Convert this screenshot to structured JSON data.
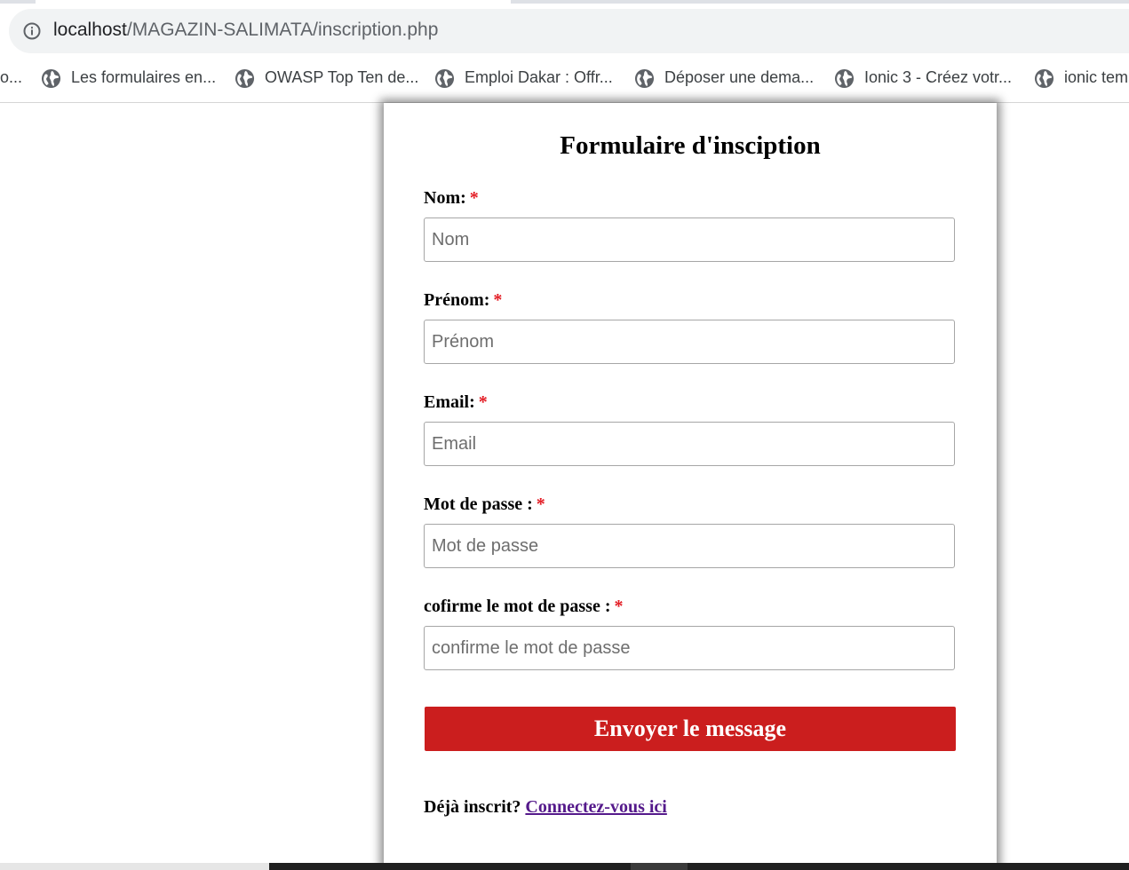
{
  "browser": {
    "url_host": "localhost",
    "url_path": "/MAGAZIN-SALIMATA/inscription.php",
    "info_icon": "info-icon",
    "bookmarks": [
      {
        "label": "o...",
        "icon": "globe-icon"
      },
      {
        "label": "Les formulaires en...",
        "icon": "globe-icon"
      },
      {
        "label": "OWASP Top Ten de...",
        "icon": "globe-icon"
      },
      {
        "label": "Emploi Dakar : Offr...",
        "icon": "globe-icon"
      },
      {
        "label": "Déposer une dema...",
        "icon": "globe-icon"
      },
      {
        "label": "Ionic 3 - Créez votr...",
        "icon": "globe-icon"
      },
      {
        "label": "ionic tem",
        "icon": "globe-icon"
      }
    ]
  },
  "form": {
    "title": "Formulaire d'insciption",
    "required_mark": "*",
    "fields": [
      {
        "label": "Nom:",
        "placeholder": "Nom"
      },
      {
        "label": "Prénom:",
        "placeholder": "Prénom"
      },
      {
        "label": "Email:",
        "placeholder": "Email"
      },
      {
        "label": "Mot de passe :",
        "placeholder": "Mot de passe"
      },
      {
        "label": "cofirme le mot de passe :",
        "placeholder": "confirme le mot de passe"
      }
    ],
    "submit_label": "Envoyer le message",
    "already_text": "Déjà inscrit?",
    "login_link": "Connectez-vous ici"
  },
  "colors": {
    "accent_red": "#cb1e1e",
    "required_red": "#e31b23",
    "link_visited": "#551a8b"
  }
}
